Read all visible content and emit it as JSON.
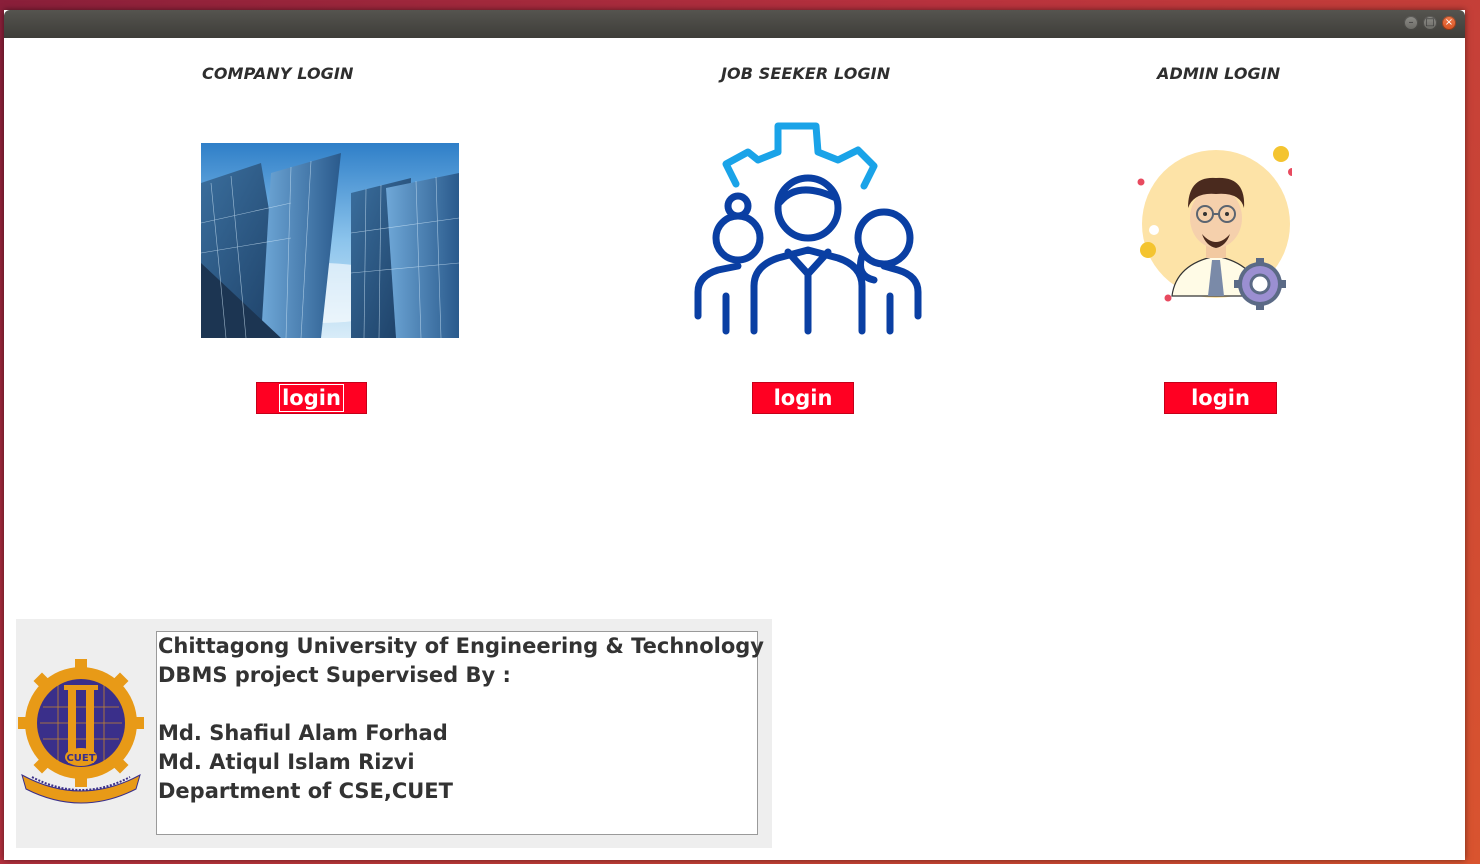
{
  "window": {
    "controls": [
      "minimize",
      "maximize",
      "close"
    ]
  },
  "sections": {
    "company": {
      "title": "COMPANY LOGIN",
      "button": "login",
      "image": "office-buildings-image"
    },
    "seeker": {
      "title": "JOB SEEKER LOGIN",
      "button": "login",
      "image": "team-gear-icon"
    },
    "admin": {
      "title": "ADMIN LOGIN",
      "button": "login",
      "image": "admin-avatar-icon"
    }
  },
  "footer": {
    "logo": "cuet-logo",
    "lines": [
      "Chittagong University of Engineering & Technology",
      "DBMS project Supervised By :",
      "",
      "Md. Shafiul Alam Forhad",
      "Md. Atiqul Islam Rizvi",
      "Department of CSE,CUET"
    ]
  },
  "colors": {
    "login_button": "#ff0022",
    "seeker_icon_dark": "#0a3fa3",
    "seeker_icon_light": "#1aa3e8"
  }
}
